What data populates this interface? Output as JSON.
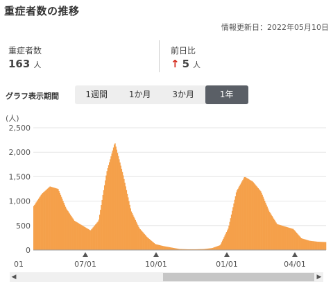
{
  "header": {
    "title": "重症者数の推移",
    "updated": "情報更新日：2022年05月10日"
  },
  "stats": {
    "severe_label": "重症者数",
    "severe_value": "163",
    "severe_unit": "人",
    "prev_label": "前日比",
    "prev_arrow": "↑",
    "prev_value": "5",
    "prev_unit": "人"
  },
  "period": {
    "label": "グラフ表示期間",
    "tabs": [
      "1週間",
      "1か月",
      "3か月",
      "1年"
    ],
    "active": 3
  },
  "scrollbar": {
    "left_arrow": "◀",
    "right_arrow": "▶"
  },
  "colors": {
    "bar": "#f5a04a",
    "bar_edge": "#e08a2e",
    "active_tab": "#5a5f66",
    "arrow_up": "#d42b1e"
  },
  "chart_data": {
    "type": "bar",
    "ylabel": "(人)",
    "ylim": [
      0,
      2500
    ],
    "yticks": [
      "0",
      "500",
      "1,000",
      "1,500",
      "2,000",
      "2,500"
    ],
    "xtick_labels": [
      "01",
      "07/01",
      "10/01",
      "01/01",
      "04/01"
    ],
    "x": [
      "05-10",
      "05-20",
      "05-31",
      "06-10",
      "06-20",
      "06-30",
      "07-10",
      "07-20",
      "07-31",
      "08-10",
      "08-20",
      "08-31",
      "09-10",
      "09-20",
      "09-30",
      "10-10",
      "10-20",
      "10-31",
      "11-10",
      "11-20",
      "11-30",
      "12-10",
      "12-20",
      "12-31",
      "01-10",
      "01-20",
      "01-31",
      "02-10",
      "02-20",
      "02-28",
      "03-10",
      "03-20",
      "03-31",
      "04-10",
      "04-20",
      "04-30",
      "05-10"
    ],
    "values": [
      900,
      1150,
      1300,
      1250,
      850,
      600,
      500,
      400,
      600,
      1600,
      2200,
      1550,
      800,
      450,
      260,
      120,
      80,
      50,
      20,
      15,
      15,
      20,
      40,
      100,
      450,
      1200,
      1500,
      1400,
      1200,
      800,
      530,
      480,
      430,
      240,
      190,
      170,
      163
    ]
  }
}
